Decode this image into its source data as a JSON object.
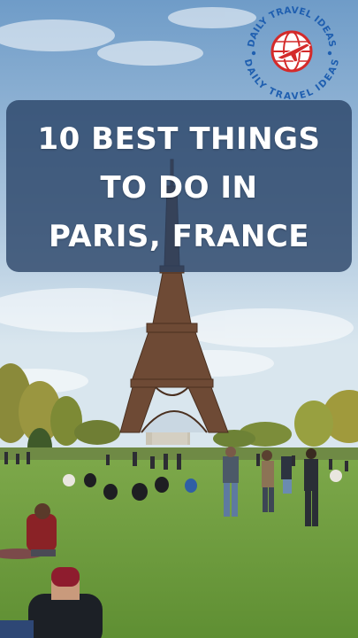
{
  "title": {
    "lines": [
      "10 BEST THINGS",
      "TO DO IN",
      "PARIS, FRANCE"
    ]
  },
  "logo": {
    "top_text": "DAILY TRAVEL IDEAS",
    "bottom_text": "DAILY TRAVEL IDEAS",
    "icon": "globe-plane-icon",
    "colors": {
      "ring_text": "#1f5fb0",
      "globe": "#d42a2a"
    }
  },
  "scene": {
    "subject": "eiffel-tower",
    "colors": {
      "sky_top": "#6f9cc8",
      "sky_bottom": "#d9e6ee",
      "grass": "#6d9a3c",
      "tower": "#6e4a35"
    }
  }
}
